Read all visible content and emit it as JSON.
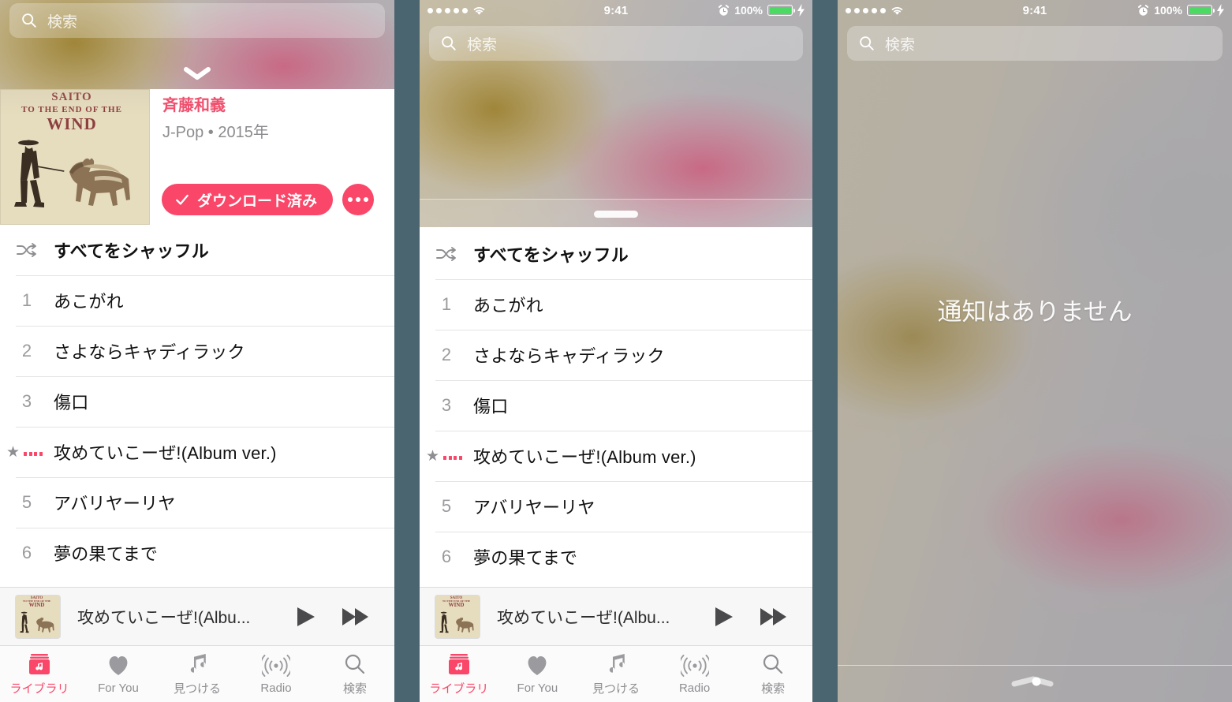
{
  "theme": {
    "accent_pink": "#FA4668",
    "artist_pink": "#F0506E",
    "separator_slate": "#4A6570",
    "battery_green": "#4CD964",
    "list_text": "#111111",
    "muted_gray": "#8E8E92"
  },
  "status_bar": {
    "signal_dots": 5,
    "wifi_icon": "wifi-icon",
    "time": "9:41",
    "alarm_icon": "alarm-clock-icon",
    "battery_percent": "100%",
    "charging_icon": "lightning-bolt-icon"
  },
  "search": {
    "placeholder": "検索",
    "icon": "search-icon"
  },
  "album": {
    "cover": {
      "line1": "SAITO",
      "line2": "TO THE END OF THE",
      "line3": "WIND",
      "alt": "album-artwork-donkey"
    },
    "artist": "斉藤和義",
    "genre_year": "J-Pop • 2015年",
    "download_button": {
      "label": "ダウンロード済み",
      "icon": "checkmark-icon"
    },
    "more_button": {
      "label": "",
      "icon": "ellipsis-icon"
    }
  },
  "tracklist": {
    "shuffle": {
      "label": "すべてをシャッフル",
      "icon": "shuffle-icon"
    },
    "tracks": [
      {
        "num": "1",
        "title": "あこがれ",
        "playing": false,
        "starred": false
      },
      {
        "num": "2",
        "title": "さよならキャディラック",
        "playing": false,
        "starred": false
      },
      {
        "num": "3",
        "title": "傷口",
        "playing": false,
        "starred": false
      },
      {
        "num": "4",
        "title": "攻めていこーぜ!(Album ver.)",
        "playing": true,
        "starred": true
      },
      {
        "num": "5",
        "title": "アバリヤーリヤ",
        "playing": false,
        "starred": false
      },
      {
        "num": "6",
        "title": "夢の果てまで",
        "playing": false,
        "starred": false
      }
    ]
  },
  "mini_player": {
    "title": "攻めていこーぜ!(Albu...",
    "play_icon": "play-icon",
    "next_icon": "fast-forward-icon",
    "artwork": "mini-album-artwork"
  },
  "tab_bar": {
    "active_index": 0,
    "tabs": [
      {
        "label": "ライブラリ",
        "icon": "library-icon"
      },
      {
        "label": "For You",
        "icon": "heart-icon"
      },
      {
        "label": "見つける",
        "icon": "music-note-icon"
      },
      {
        "label": "Radio",
        "icon": "radio-waves-icon"
      },
      {
        "label": "検索",
        "icon": "search-icon"
      }
    ]
  },
  "notification_center": {
    "empty_message": "通知はありません",
    "grabber_icon": "grabber-handle-icon"
  },
  "handles": {
    "chevron_down_icon": "chevron-down-icon",
    "drag_pill_icon": "drag-pill-handle"
  }
}
